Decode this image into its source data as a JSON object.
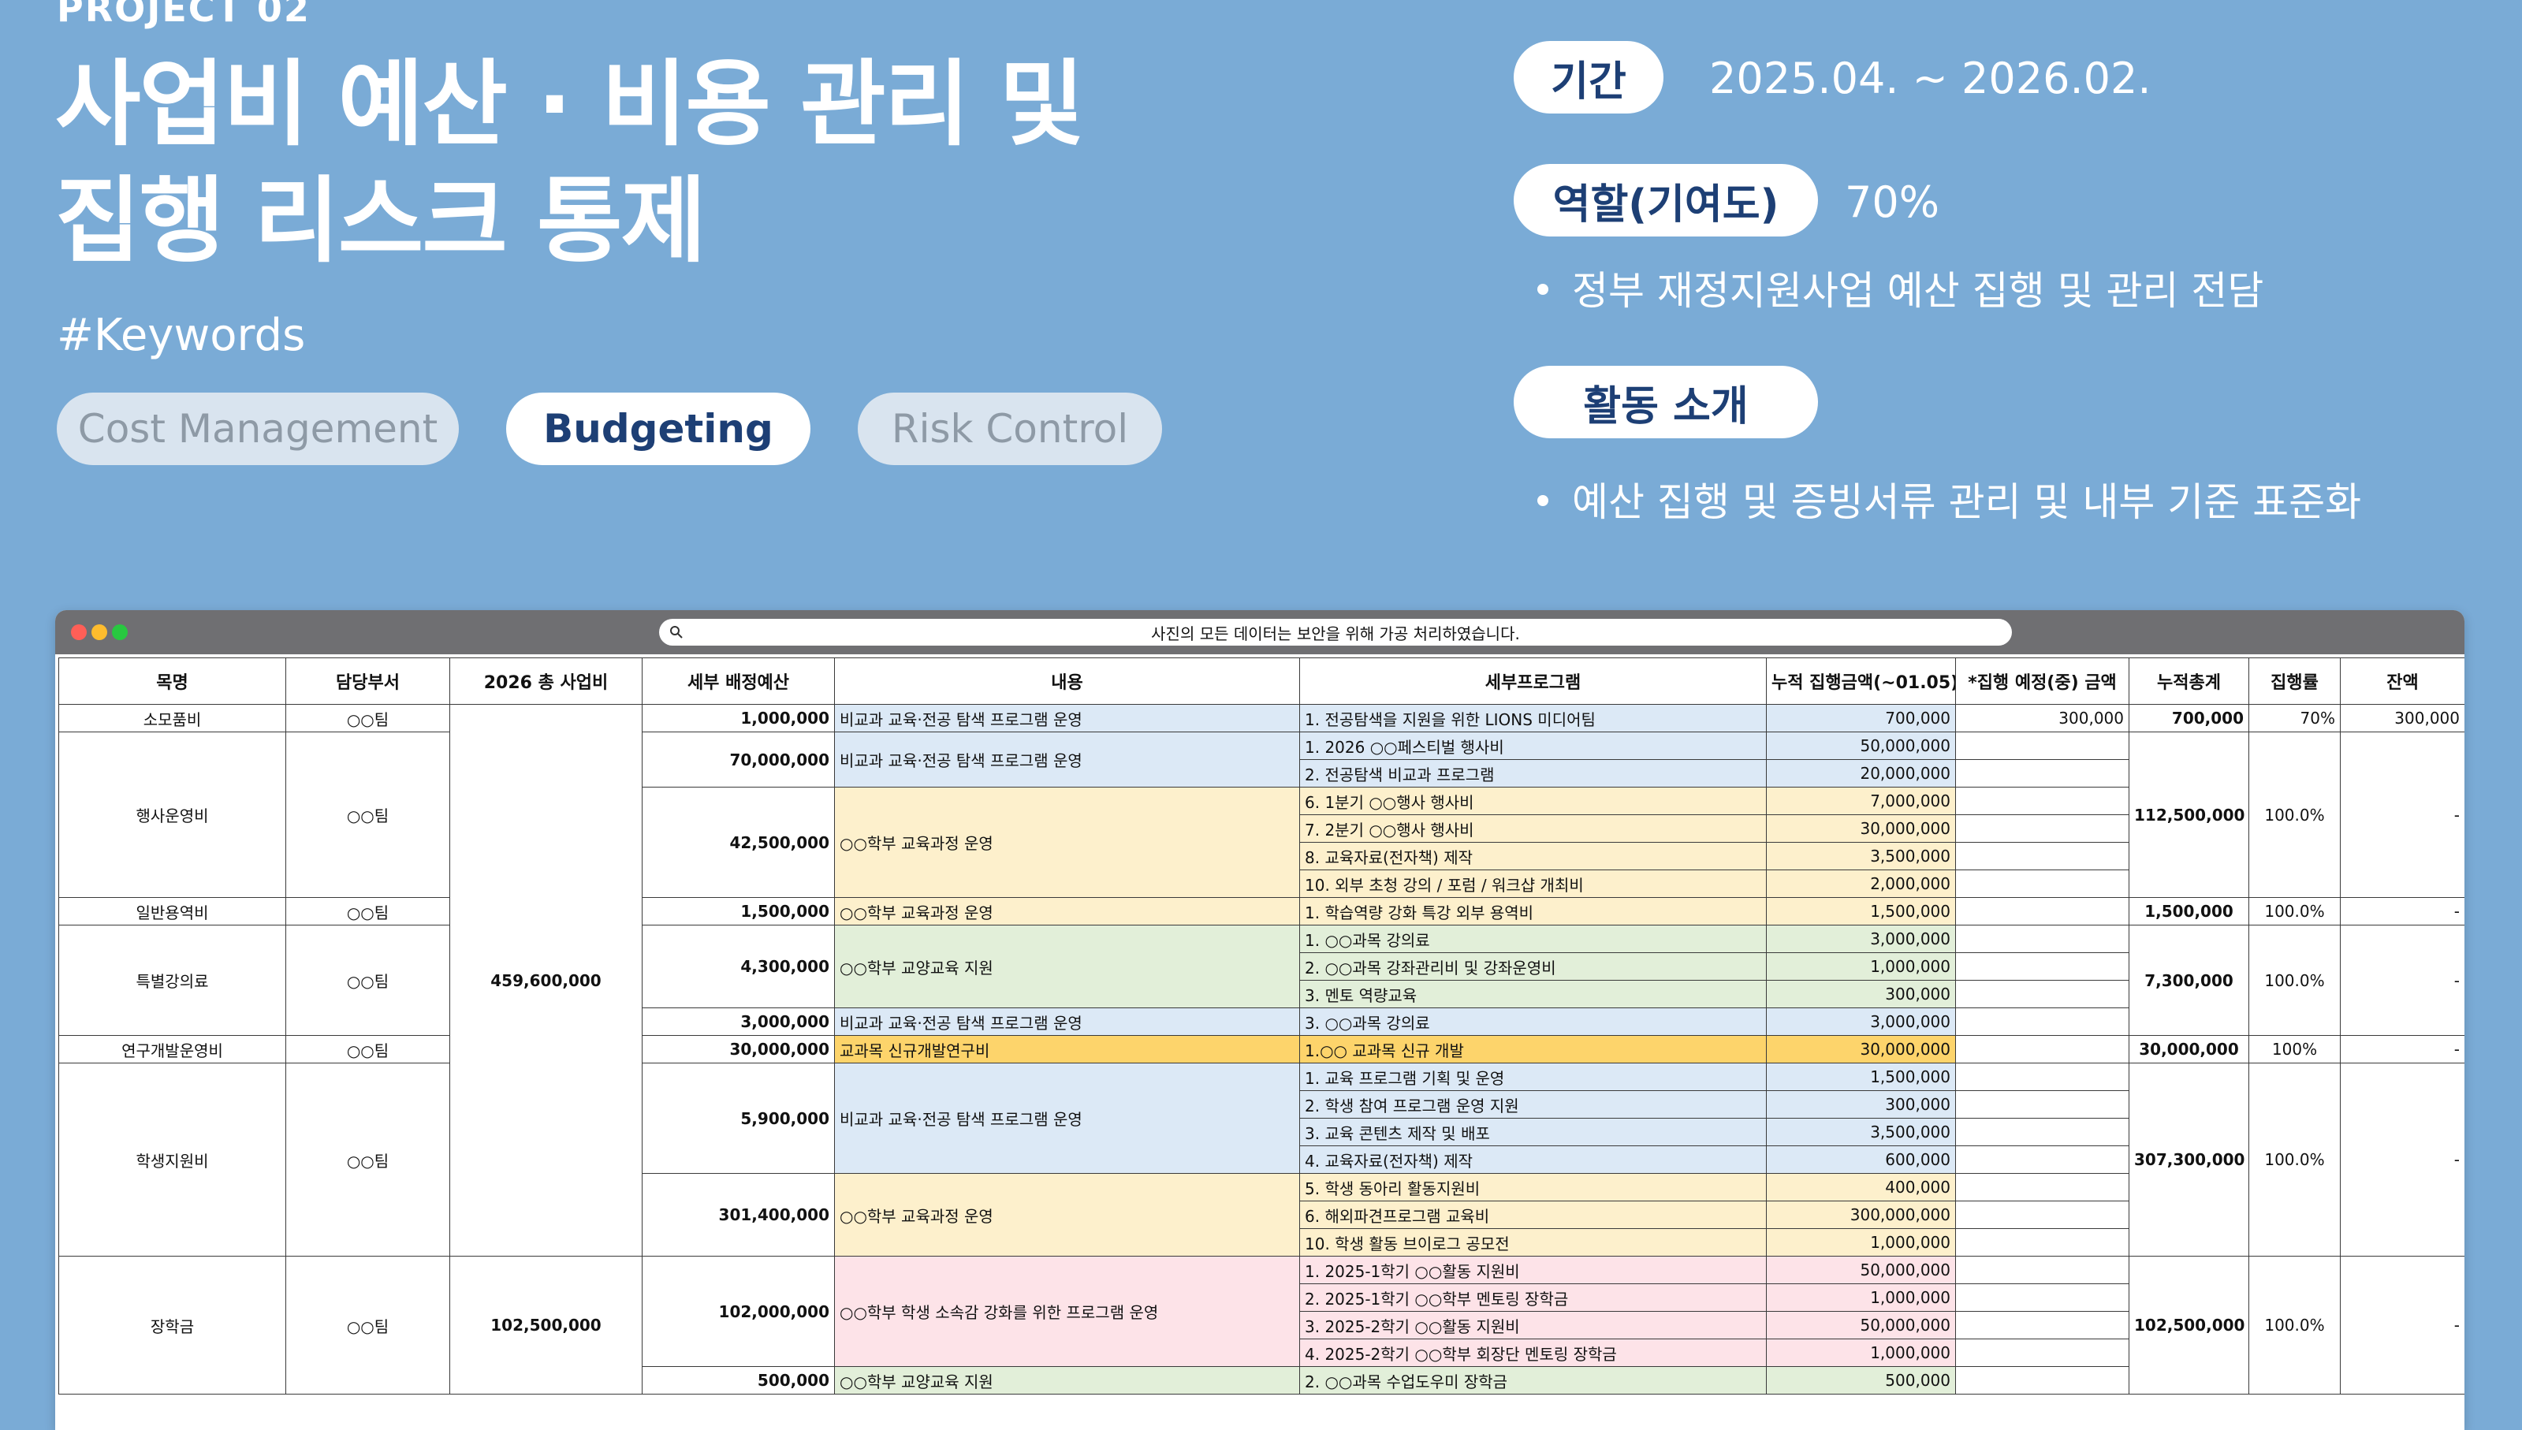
{
  "header": {
    "project_label": "PROJECT 02",
    "title_line1": "사업비 예산 · 비용 관리 및",
    "title_line2": "집행 리스크 통제",
    "keywords_heading": "#Keywords",
    "keywords": [
      {
        "label": "Cost Management",
        "active": false
      },
      {
        "label": "Budgeting",
        "active": true
      },
      {
        "label": "Risk Control",
        "active": false
      }
    ]
  },
  "info": {
    "period_label": "기간",
    "period_value": "2025.04. ~ 2026.02.",
    "role_label": "역할(기여도)",
    "role_value": "70%",
    "role_bullet": "정부 재정지원사업 예산 집행 및 관리 전담",
    "activity_label": "활동 소개",
    "activity_bullet": "예산 집행 및 증빙서류 관리 및 내부 기준 표준화"
  },
  "window": {
    "address_text": "사진의 모든 데이터는 보안을 위해 가공 처리하였습니다."
  },
  "table": {
    "headers": [
      "목명",
      "담당부서",
      "2026 총 사업비",
      "세부 배정예산",
      "내용",
      "세부프로그램",
      "누적 집행금액(~01.05)",
      "*집행 예정(중) 금액",
      "누적총계",
      "집행률",
      "잔액"
    ],
    "rows": [
      {
        "mok": "소모품비",
        "dept": "○○팀",
        "total": "",
        "alloc": "1,000,000",
        "content": "비교과 교육·전공 탐색 프로그램 운영",
        "program": "1. 전공탐색을 지원을 위한 LIONS 미디어팀",
        "spent": "700,000",
        "planned": "300,000",
        "cum": "700,000",
        "rate": "70%",
        "bal": "300,000"
      },
      {
        "mok": "행사운영비",
        "dept": "○○팀",
        "total": "",
        "alloc": "70,000,000",
        "content": "비교과 교육·전공 탐색 프로그램 운영",
        "program": "1. 2026 ○○페스티벌 행사비",
        "spent": "50,000,000",
        "planned": "",
        "cum": "112,500,000",
        "rate": "100.0%",
        "bal": "-"
      },
      {
        "program": "2. 전공탐색 비교과 프로그램",
        "spent": "20,000,000",
        "planned": ""
      },
      {
        "alloc": "42,500,000",
        "content": "○○학부 교육과정 운영",
        "program": "6. 1분기 ○○행사 행사비",
        "spent": "7,000,000",
        "planned": ""
      },
      {
        "program": "7. 2분기 ○○행사 행사비",
        "spent": "30,000,000",
        "planned": ""
      },
      {
        "program": "8. 교육자료(전자책) 제작",
        "spent": "3,500,000",
        "planned": ""
      },
      {
        "program": "10. 외부 초청 강의 / 포럼 / 워크샵 개최비",
        "spent": "2,000,000",
        "planned": ""
      },
      {
        "mok": "일반용역비",
        "dept": "○○팀",
        "alloc": "1,500,000",
        "content": "○○학부 교육과정 운영",
        "program": "1. 학습역량 강화 특강 외부 용역비",
        "spent": "1,500,000",
        "planned": "",
        "cum": "1,500,000",
        "rate": "100.0%",
        "bal": "-"
      },
      {
        "mok": "특별강의료",
        "dept": "○○팀",
        "alloc": "4,300,000",
        "content": "○○학부 교양교육 지원",
        "program": "1. ○○과목 강의료",
        "spent": "3,000,000",
        "planned": "",
        "cum": "7,300,000",
        "rate": "100.0%",
        "bal": "-"
      },
      {
        "program": "2. ○○과목 강좌관리비 및 강좌운영비",
        "spent": "1,000,000",
        "planned": ""
      },
      {
        "program": "3. 멘토 역량교육",
        "spent": "300,000",
        "planned": ""
      },
      {
        "alloc": "3,000,000",
        "content": "비교과 교육·전공 탐색 프로그램 운영",
        "program": "3. ○○과목 강의료",
        "spent": "3,000,000",
        "planned": ""
      },
      {
        "mok": "연구개발운영비",
        "dept": "○○팀",
        "alloc": "30,000,000",
        "content": "교과목 신규개발연구비",
        "program": "1.○○ 교과목 신규 개발",
        "spent": "30,000,000",
        "planned": "",
        "cum": "30,000,000",
        "rate": "100%",
        "bal": "-"
      },
      {
        "mok": "학생지원비",
        "dept": "○○팀",
        "alloc": "5,900,000",
        "content": "비교과 교육·전공 탐색 프로그램 운영",
        "program": "1. 교육 프로그램 기획 및 운영",
        "spent": "1,500,000",
        "planned": "",
        "cum": "307,300,000",
        "rate": "100.0%",
        "bal": "-"
      },
      {
        "program": "2. 학생 참여 프로그램 운영 지원",
        "spent": "300,000",
        "planned": ""
      },
      {
        "program": "3. 교육 콘텐츠 제작 및 배포",
        "spent": "3,500,000",
        "planned": ""
      },
      {
        "program": "4. 교육자료(전자책) 제작",
        "spent": "600,000",
        "planned": ""
      },
      {
        "alloc": "301,400,000",
        "content": "○○학부 교육과정 운영",
        "program": "5. 학생 동아리 활동지원비",
        "spent": "400,000",
        "planned": ""
      },
      {
        "program": "6. 해외파견프로그램 교육비",
        "spent": "300,000,000",
        "planned": ""
      },
      {
        "program": "10. 학생 활동 브이로그 공모전",
        "spent": "1,000,000",
        "planned": ""
      },
      {
        "mok": "장학금",
        "dept": "○○팀",
        "total": "102,500,000",
        "alloc": "102,000,000",
        "content": "○○학부 학생 소속감 강화를 위한 프로그램 운영",
        "program": "1. 2025-1학기 ○○활동 지원비",
        "spent": "50,000,000",
        "planned": "",
        "cum": "102,500,000",
        "rate": "100.0%",
        "bal": "-"
      },
      {
        "program": "2. 2025-1학기 ○○학부 멘토링 장학금",
        "spent": "1,000,000",
        "planned": ""
      },
      {
        "program": "3. 2025-2학기 ○○활동 지원비",
        "spent": "50,000,000",
        "planned": ""
      },
      {
        "program": "4. 2025-2학기 ○○학부 회장단 멘토링 장학금",
        "spent": "1,000,000",
        "planned": ""
      },
      {
        "alloc": "500,000",
        "content": "○○학부 교양교육 지원",
        "program": "2. ○○과목 수업도우미 장학금",
        "spent": "500,000",
        "planned": ""
      }
    ],
    "total_merged_1": "459,600,000"
  },
  "colors": {
    "background": "#7aabd6",
    "accent_text": "#1d3f75",
    "row_blue": "#dce9f6",
    "row_yellow": "#fdf0cc",
    "row_green": "#e2efd9",
    "row_pink": "#fde3e8",
    "row_orange": "#fdd46b"
  }
}
